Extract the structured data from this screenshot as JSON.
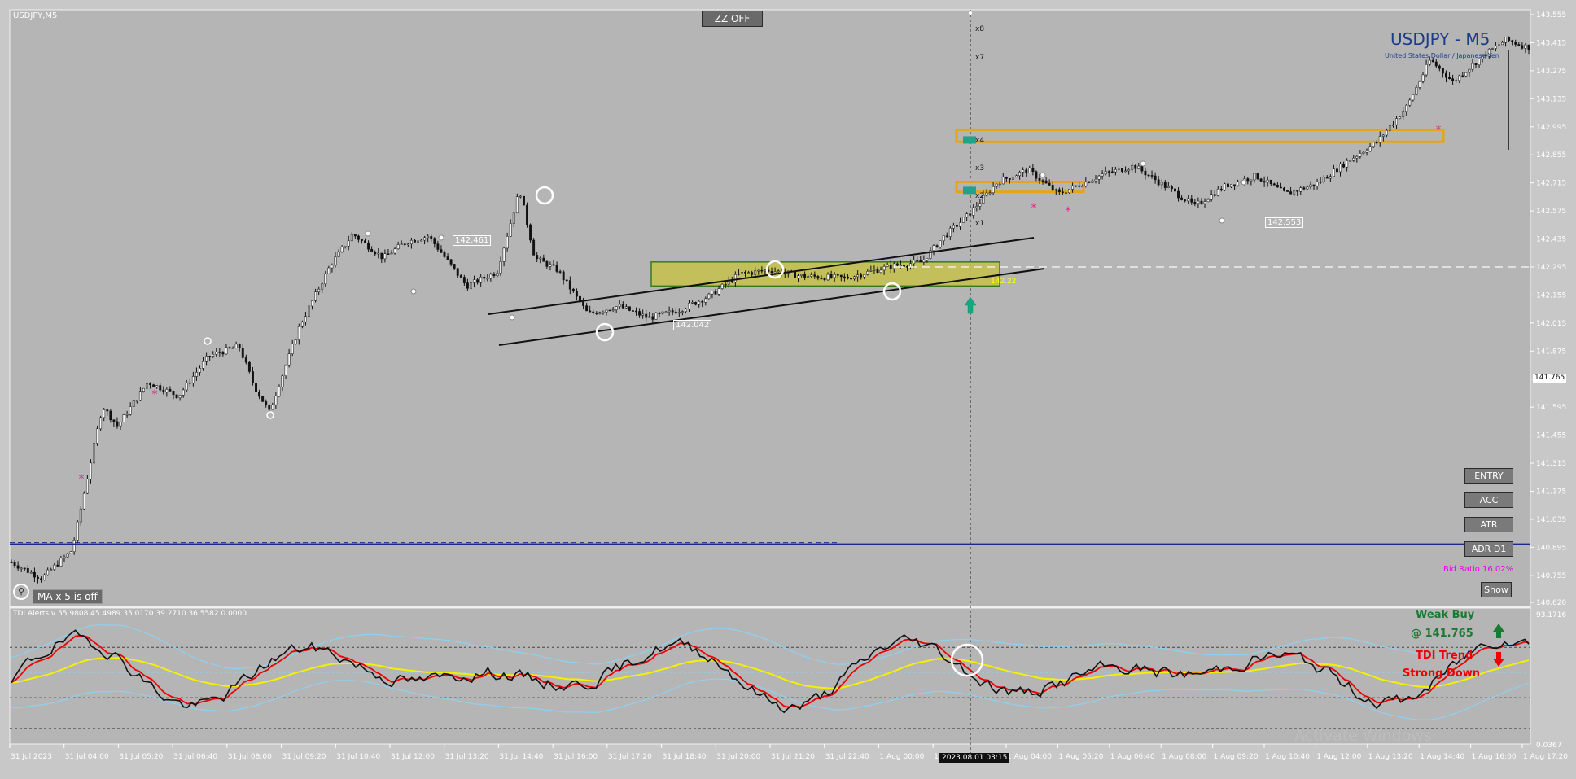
{
  "symbol_label": "USDJPY,M5",
  "title": "USDJPY - M5",
  "subtitle": "United States Dollar / Japanese Yen",
  "buttons": {
    "zz": "ZZ OFF",
    "entry": "ENTRY",
    "acc": "ACC",
    "atr": "ATR",
    "adr": "ADR D1",
    "show": "Show"
  },
  "ma_status": "MA x 5 is off",
  "bid_ratio": "Bid Ratio 16.02%",
  "crosshair_time": "2023.08.01 03:15",
  "indicator_header": "TDI Alerts v 55.9808 45.4989 35.0170 39.2710 36.5582 0.0000",
  "tdi_signal": {
    "weak_buy": "Weak Buy",
    "price": "@ 141.765",
    "trend": "TDI Trend",
    "strong_down": "Strong Down"
  },
  "watermark": "Activate Windows",
  "price_axis": [
    "143.555",
    "143.415",
    "143.275",
    "143.135",
    "142.995",
    "142.855",
    "142.715",
    "142.575",
    "142.435",
    "142.295",
    "142.155",
    "142.015",
    "141.875",
    "141.735",
    "141.595",
    "141.455",
    "141.315",
    "141.175",
    "141.035",
    "140.895",
    "140.755",
    "140.620"
  ],
  "current_price": "141.765",
  "sub_axis": {
    "top": "93.1716",
    "bottom": "0.0367"
  },
  "time_axis": [
    "31 Jul 2023",
    "31 Jul 04:00",
    "31 Jul 05:20",
    "31 Jul 06:40",
    "31 Jul 08:00",
    "31 Jul 09:20",
    "31 Jul 10:40",
    "31 Jul 12:00",
    "31 Jul 13:20",
    "31 Jul 14:40",
    "31 Jul 16:00",
    "31 Jul 17:20",
    "31 Jul 18:40",
    "31 Jul 20:00",
    "31 Jul 21:20",
    "31 Jul 22:40",
    "1 Aug 00:00",
    "1 Aug 01:20",
    "1 Aug 04:00",
    "1 Aug 05:20",
    "1 Aug 06:40",
    "1 Aug 08:00",
    "1 Aug 09:20",
    "1 Aug 10:40",
    "1 Aug 12:00",
    "1 Aug 13:20",
    "1 Aug 14:40",
    "1 Aug 16:00",
    "1 Aug 17:20"
  ],
  "level_labels": {
    "a": "142.461",
    "b": "142.042",
    "c": "142.553",
    "d": "142.22"
  },
  "fib_labels": [
    "x8",
    "x7",
    "x4",
    "x3",
    "x2",
    "x1"
  ],
  "colors": {
    "bg": "#c8c8c8",
    "title": "#1a3d8a",
    "zone_orange": "#e8a317",
    "zone_green": "#c8d63c",
    "tdi_red": "#ee0000",
    "tdi_yellow": "#f5f000",
    "tdi_blue": "#8fd0f0",
    "bid_ratio": "#ee00ee",
    "weak_buy": "#1b7a32",
    "strong_down": "#ee0000",
    "adr_line": "#1a2a8a"
  },
  "chart_data": {
    "type": "candlestick",
    "symbol": "USDJPY",
    "timeframe": "M5",
    "x_range": [
      "31 Jul 2023",
      "1 Aug 17:20"
    ],
    "ylim": [
      140.62,
      143.555
    ],
    "y_ticks": [
      143.555,
      143.415,
      143.275,
      143.135,
      142.995,
      142.855,
      142.715,
      142.575,
      142.435,
      142.295,
      142.155,
      142.015,
      141.875,
      141.735,
      141.595,
      141.455,
      141.315,
      141.175,
      141.035,
      140.895,
      140.755,
      140.62
    ],
    "close_path": [
      [
        0,
        140.82
      ],
      [
        0.02,
        140.74
      ],
      [
        0.04,
        140.88
      ],
      [
        0.06,
        141.6
      ],
      [
        0.07,
        141.5
      ],
      [
        0.09,
        141.72
      ],
      [
        0.11,
        141.65
      ],
      [
        0.13,
        141.85
      ],
      [
        0.15,
        141.9
      ],
      [
        0.16,
        141.7
      ],
      [
        0.17,
        141.57
      ],
      [
        0.19,
        142.0
      ],
      [
        0.21,
        142.3
      ],
      [
        0.225,
        142.46
      ],
      [
        0.245,
        142.34
      ],
      [
        0.26,
        142.42
      ],
      [
        0.275,
        142.45
      ],
      [
        0.3,
        142.2
      ],
      [
        0.32,
        142.27
      ],
      [
        0.335,
        142.68
      ],
      [
        0.345,
        142.34
      ],
      [
        0.36,
        142.28
      ],
      [
        0.38,
        142.06
      ],
      [
        0.4,
        142.1
      ],
      [
        0.42,
        142.04
      ],
      [
        0.44,
        142.08
      ],
      [
        0.46,
        142.15
      ],
      [
        0.48,
        142.26
      ],
      [
        0.5,
        142.28
      ],
      [
        0.52,
        142.25
      ],
      [
        0.55,
        142.24
      ],
      [
        0.58,
        142.3
      ],
      [
        0.6,
        142.32
      ],
      [
        0.615,
        142.45
      ],
      [
        0.63,
        142.55
      ],
      [
        0.65,
        142.72
      ],
      [
        0.67,
        142.78
      ],
      [
        0.69,
        142.66
      ],
      [
        0.72,
        142.76
      ],
      [
        0.74,
        142.8
      ],
      [
        0.76,
        142.7
      ],
      [
        0.78,
        142.6
      ],
      [
        0.8,
        142.7
      ],
      [
        0.82,
        142.75
      ],
      [
        0.84,
        142.66
      ],
      [
        0.86,
        142.71
      ],
      [
        0.88,
        142.82
      ],
      [
        0.9,
        142.92
      ],
      [
        0.92,
        143.1
      ],
      [
        0.935,
        143.33
      ],
      [
        0.95,
        143.22
      ],
      [
        0.97,
        143.35
      ],
      [
        0.985,
        143.43
      ],
      [
        1.0,
        143.39
      ]
    ],
    "zones": [
      {
        "kind": "rectangle",
        "color": "orange",
        "y": [
          142.92,
          142.98
        ]
      },
      {
        "kind": "rectangle",
        "color": "orange",
        "y": [
          142.67,
          142.72
        ]
      },
      {
        "kind": "rectangle",
        "color": "green",
        "y": [
          142.2,
          142.32
        ]
      }
    ],
    "horizontal_lines": [
      {
        "y": 140.91,
        "style": "solid",
        "color": "navy"
      },
      {
        "y": 142.295,
        "style": "dashed",
        "color": "white"
      }
    ],
    "indicator": {
      "name": "TDI Alerts",
      "ylim": [
        0.0367,
        93.1716
      ],
      "series": [
        {
          "color": "black"
        },
        {
          "color": "red"
        },
        {
          "color": "yellow"
        },
        {
          "color": "lightblue"
        }
      ]
    }
  }
}
